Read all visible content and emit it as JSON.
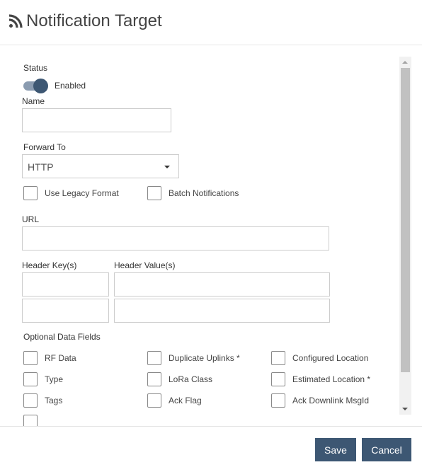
{
  "header": {
    "title": "Notification Target",
    "icon": "rss-icon"
  },
  "form": {
    "status_label": "Status",
    "status_toggle_label": "Enabled",
    "status_enabled": true,
    "name_label": "Name",
    "name_value": "",
    "forward_to_label": "Forward To",
    "forward_to_value": "HTTP",
    "use_legacy_format_label": "Use Legacy Format",
    "use_legacy_format_checked": false,
    "batch_notifications_label": "Batch Notifications",
    "batch_notifications_checked": false,
    "url_label": "URL",
    "url_value": "",
    "header_keys_label": "Header Key(s)",
    "header_values_label": "Header Value(s)",
    "header_rows": [
      {
        "key": "",
        "value": ""
      },
      {
        "key": "",
        "value": ""
      }
    ],
    "optional_fields_label": "Optional Data Fields",
    "optional_fields": [
      {
        "label": "RF Data",
        "checked": false
      },
      {
        "label": "Duplicate Uplinks *",
        "checked": false
      },
      {
        "label": "Configured Location",
        "checked": false
      },
      {
        "label": "Type",
        "checked": false
      },
      {
        "label": "LoRa Class",
        "checked": false
      },
      {
        "label": "Estimated Location *",
        "checked": false
      },
      {
        "label": "Tags",
        "checked": false
      },
      {
        "label": "Ack Flag",
        "checked": false
      },
      {
        "label": "Ack Downlink MsgId",
        "checked": false
      }
    ]
  },
  "footer": {
    "save_label": "Save",
    "cancel_label": "Cancel"
  },
  "colors": {
    "accent": "#3d5773",
    "toggle_track": "#8a9bb0"
  }
}
